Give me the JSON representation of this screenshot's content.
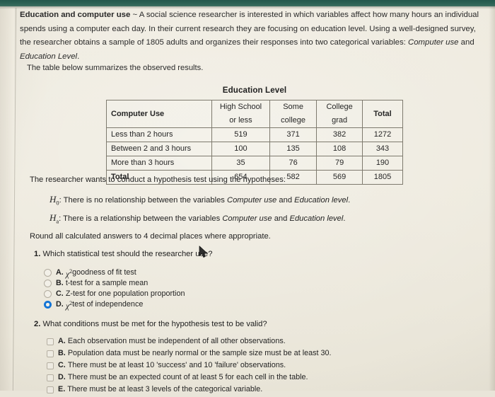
{
  "document": {
    "title_bold": "Education and computer use",
    "title_sep": " ~ ",
    "intro_part1": "A social science researcher is interested in which variables affect how many hours an individual spends using a computer each day. In their current research they are focusing on education level. Using a well-designed survey, the researcher obtains a sample of 1805 adults and organizes their responses into two categorical variables: ",
    "intro_italic1": "Computer use",
    "intro_and": " and ",
    "intro_italic2": "Education Level",
    "intro_end": ".",
    "table_lead": "The table below summarizes the observed results."
  },
  "table": {
    "caption": "Education Level",
    "row_header_label": "Computer Use",
    "column_headers": [
      "High School or less",
      "Some college",
      "College grad",
      "Total"
    ],
    "rows": [
      {
        "label": "Less than 2 hours",
        "values": [
          "519",
          "371",
          "382",
          "1272"
        ]
      },
      {
        "label": "Between 2 and 3 hours",
        "values": [
          "100",
          "135",
          "108",
          "343"
        ]
      },
      {
        "label": "More than 3 hours",
        "values": [
          "35",
          "76",
          "79",
          "190"
        ]
      },
      {
        "label": "Total",
        "values": [
          "654",
          "582",
          "569",
          "1805"
        ]
      }
    ]
  },
  "hypotheses": {
    "lead": "The researcher wants to conduct a hypothesis test using the hypotheses:",
    "null": {
      "symbol": "H",
      "subscript": "0",
      "text_before": ": There is no relationship between the variables ",
      "var1": "Computer use",
      "conjunction": " and ",
      "var2": "Education level",
      "text_end": "."
    },
    "alternative": {
      "symbol": "H",
      "subscript": "a",
      "text_before": ": There is a relationship between the variables ",
      "var1": "Computer use",
      "conjunction": " and ",
      "var2": "Education level",
      "text_end": "."
    },
    "rounding_note": "Round all calculated answers to 4 decimal places where appropriate."
  },
  "question1": {
    "number": "1.",
    "stem": "Which statistical test should the researcher use?",
    "selected": "D",
    "options": [
      {
        "letter": "A.",
        "prefix_symbol": "chi-squared",
        "text": " goodness of fit test",
        "selected": false
      },
      {
        "letter": "B.",
        "prefix_symbol": "",
        "text": "t-test for a sample mean",
        "selected": false
      },
      {
        "letter": "C.",
        "prefix_symbol": "",
        "text": "Z-test for one population proportion",
        "selected": false
      },
      {
        "letter": "D.",
        "prefix_symbol": "chi-squared",
        "text": " test of independence",
        "selected": true
      }
    ]
  },
  "question2": {
    "number": "2.",
    "stem": "What conditions must be met for the hypothesis test to be valid?",
    "options": [
      {
        "letter": "A.",
        "text": "Each observation must be independent of all other observations.",
        "checked": false
      },
      {
        "letter": "B.",
        "text": "Population data must be nearly normal or the sample size must be at least 30.",
        "checked": false
      },
      {
        "letter": "C.",
        "text": "There must be at least 10 'success' and 10 'failure' observations.",
        "checked": false
      },
      {
        "letter": "D.",
        "text": "There must be an expected count of at least 5 for each cell in the table.",
        "checked": false
      },
      {
        "letter": "E.",
        "text": "There must be at least 3 levels of the categorical variable.",
        "checked": false
      }
    ]
  },
  "colors": {
    "top_band": "#2d6356",
    "page": "#eeeade",
    "selected_radio": "#1575d6",
    "table_border": "#7e7a6e",
    "text": "#232323"
  },
  "cursor": {
    "type": "arrow-pointer"
  }
}
